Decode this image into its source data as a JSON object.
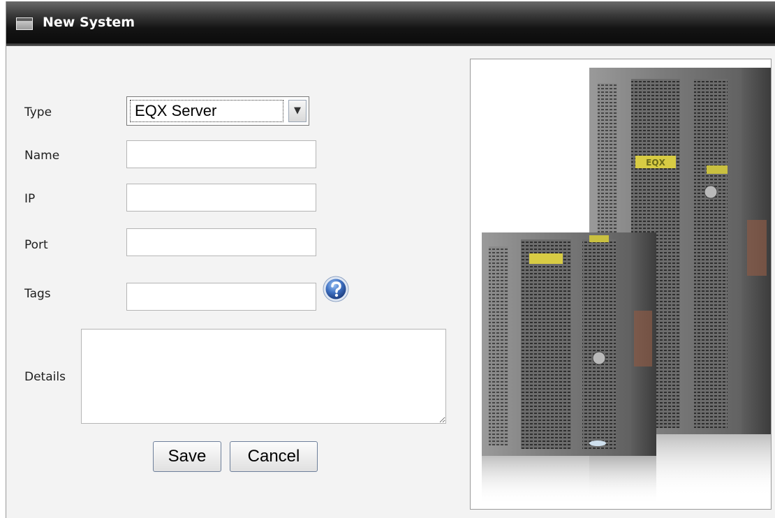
{
  "dialog": {
    "title": "New System"
  },
  "form": {
    "type_label": "Type",
    "type_value": "EQX Server",
    "name_label": "Name",
    "ip_label": "IP",
    "port_label": "Port",
    "tags_label": "Tags",
    "details_label": "Details"
  },
  "buttons": {
    "save": "Save",
    "cancel": "Cancel"
  },
  "product_image": {
    "badge_text": "EQX"
  },
  "icons": {
    "title": "window-icon",
    "help": "help-icon",
    "dropdown": "chevron-down-icon"
  },
  "colors": {
    "titlebar": "#141414",
    "help_icon": "#3d6fc0"
  }
}
